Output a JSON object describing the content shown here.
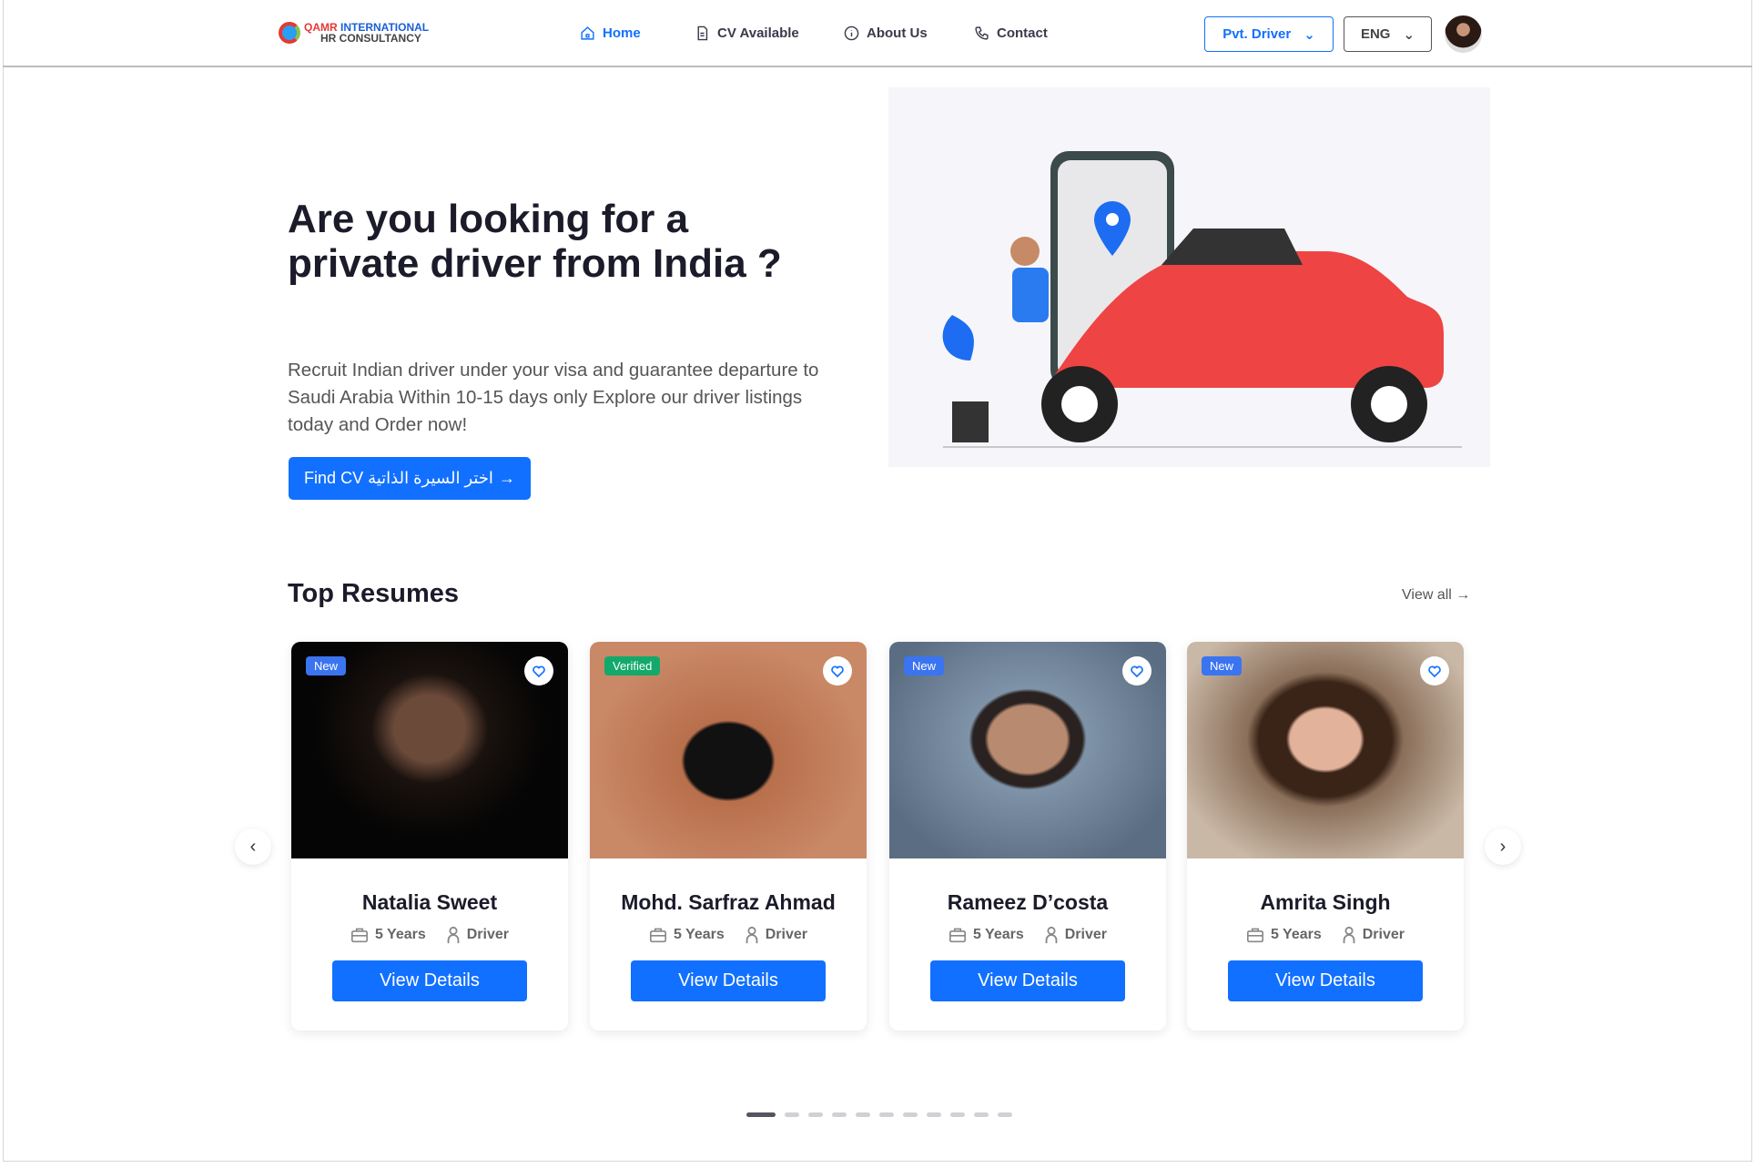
{
  "header": {
    "logo": {
      "line1_red": "QAMR",
      "line1_blue": "INTERNATIONAL",
      "line2": "HR CONSULTANCY"
    },
    "nav": [
      {
        "label": "Home",
        "icon": "home-icon",
        "active": true
      },
      {
        "label": "CV Available",
        "icon": "document-icon"
      },
      {
        "label": "About Us",
        "icon": "info-icon"
      },
      {
        "label": "Contact",
        "icon": "phone-icon"
      }
    ],
    "category_select": "Pvt. Driver",
    "language_select": "ENG"
  },
  "hero": {
    "title_line1": "Are you looking for a",
    "title_line2": "private driver from India ?",
    "text": "Recruit Indian driver under your visa and guarantee departure to Saudi Arabia Within 10-15 days only Explore our driver listings today and Order now!",
    "cta": "Find CV اختر السيرة الذاتية"
  },
  "resumes": {
    "title": "Top Resumes",
    "view_all": "View all",
    "cards": [
      {
        "name": "Natalia Sweet",
        "badge": "New",
        "experience": "5 Years",
        "role": "Driver",
        "button": "View Details"
      },
      {
        "name": "Mohd. Sarfraz Ahmad",
        "badge": "Verified",
        "experience": "5 Years",
        "role": "Driver",
        "button": "View Details"
      },
      {
        "name": "Rameez D’costa",
        "badge": "New",
        "experience": "5 Years",
        "role": "Driver",
        "button": "View Details"
      },
      {
        "name": "Amrita Singh",
        "badge": "New",
        "experience": "5 Years",
        "role": "Driver",
        "button": "View Details"
      }
    ],
    "page_count": 11,
    "current_page": 1
  },
  "colors": {
    "primary": "#1170ff",
    "badge_new": "#3b74f0",
    "badge_verified": "#13a96b",
    "car": "#ef4444"
  }
}
